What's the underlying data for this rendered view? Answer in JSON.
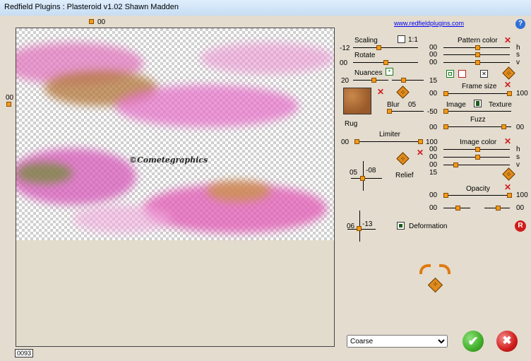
{
  "window": {
    "title": "Redfield Plugins : Plasteroid v1.02   Shawn Madden"
  },
  "header": {
    "link": "www.redfieldplugins.com",
    "help": "?"
  },
  "preview": {
    "top_value": "00",
    "left_value": "00",
    "watermark": "©Cometegraphics",
    "counter": "0093"
  },
  "left_controls": {
    "scaling": {
      "label": "Scaling",
      "value": "-12",
      "checkbox_label": "1:1"
    },
    "rotate": {
      "label": "Rotate",
      "value": "00"
    },
    "nuances": {
      "label": "Nuances",
      "value_left": "20",
      "value_right": "15"
    },
    "texture": {
      "name": "Rug"
    },
    "blur": {
      "label": "Blur",
      "value": "05"
    },
    "limiter": {
      "label": "Limiter",
      "value_left": "00",
      "value_right": "100"
    },
    "relief": {
      "label": "Relief",
      "x": "05",
      "y": "-08"
    },
    "deformation": {
      "label": "Deformation",
      "x": "06",
      "y": "-13"
    }
  },
  "right_controls": {
    "pattern_color": {
      "label": "Pattern color",
      "h": "00",
      "s": "00",
      "v": "00",
      "h_label": "h",
      "s_label": "s",
      "v_label": "v"
    },
    "frame_size": {
      "label": "Frame size",
      "value_left": "00",
      "value_right": "100"
    },
    "image_label": "Image",
    "texture_label": "Texture",
    "image_texture_value": "-50",
    "fuzz": {
      "label": "Fuzz",
      "value_left": "00",
      "value_right": "00"
    },
    "image_color": {
      "label": "Image color",
      "h": "00",
      "s": "00",
      "v": "00",
      "h_label": "h",
      "s_label": "s",
      "v_label": "v",
      "extra": "15"
    },
    "opacity": {
      "label": "Opacity",
      "value_left": "00",
      "value_right": "100",
      "row2_left": "00",
      "row2_right": "00"
    }
  },
  "footer": {
    "mode_select": "Coarse",
    "ok_label": "✔",
    "cancel_label": "✖",
    "reset_label": "R"
  },
  "colors": {
    "accent": "#f39a1a",
    "ok": "#3fae28",
    "cancel": "#d01c1c",
    "link": "#0000ee"
  }
}
